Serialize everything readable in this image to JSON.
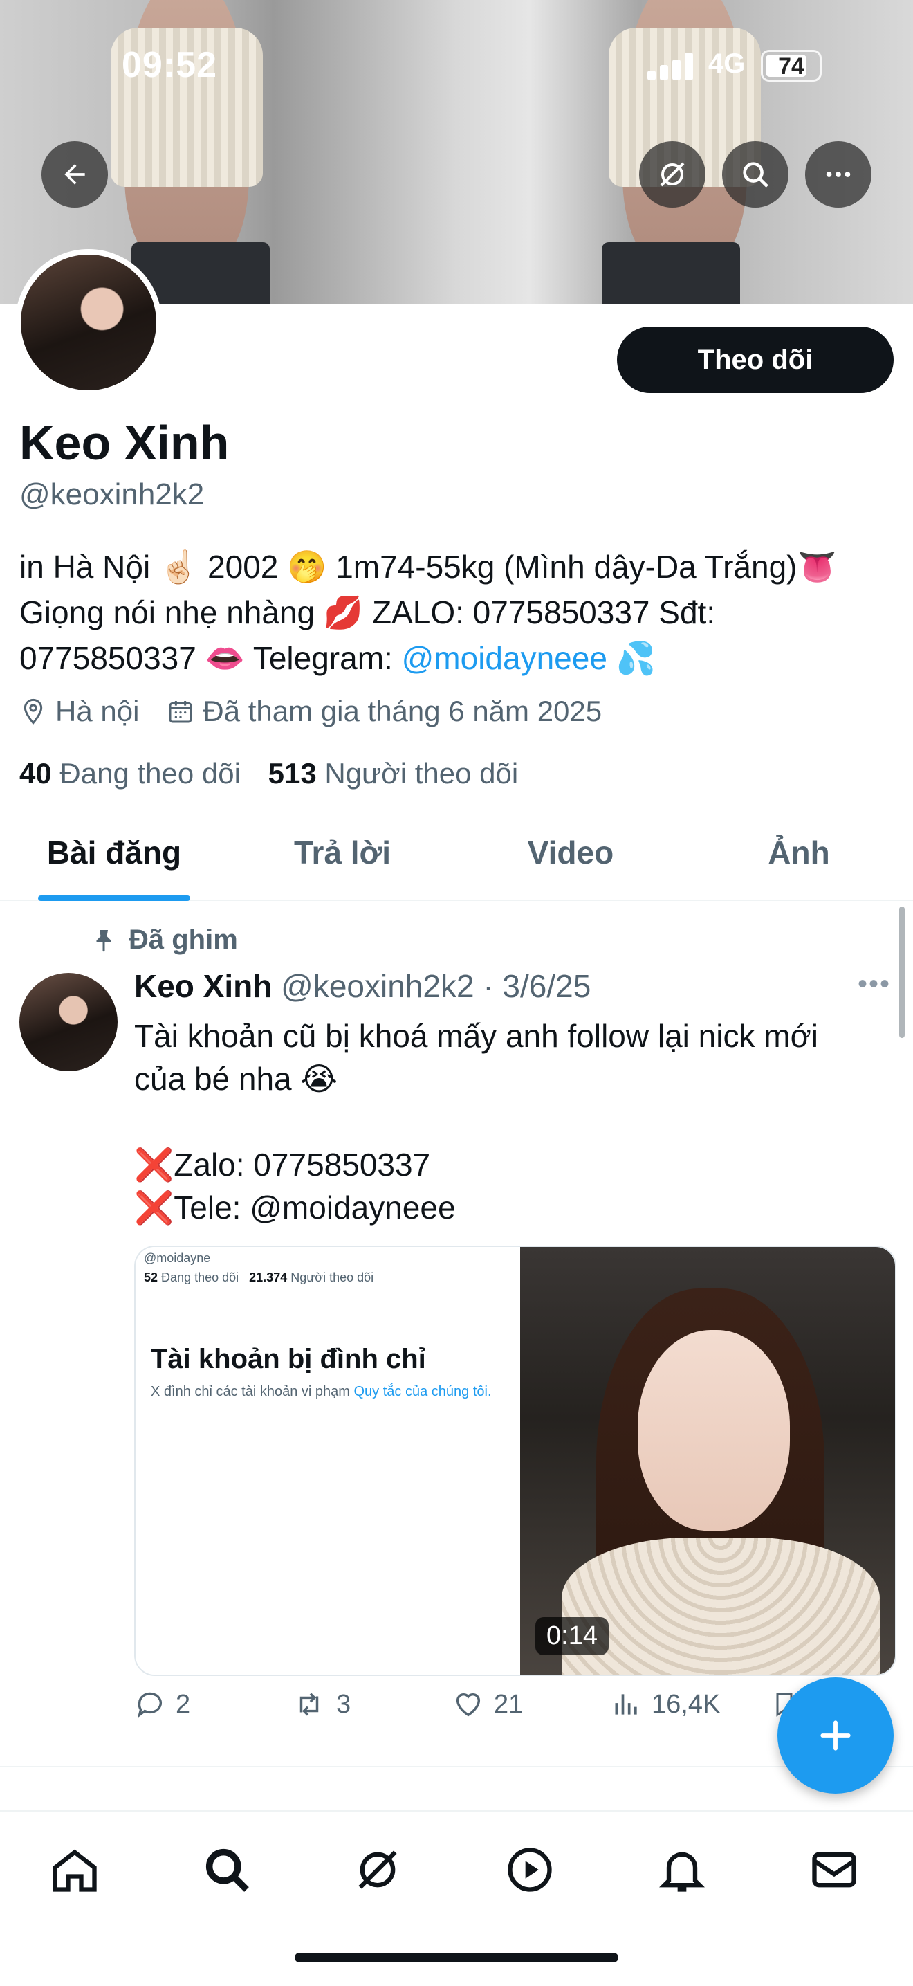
{
  "status_bar": {
    "time": "09:52",
    "network": "4G",
    "battery": "74"
  },
  "header": {
    "follow_label": "Theo dõi"
  },
  "profile": {
    "name": "Keo Xinh",
    "handle": "@keoxinh2k2",
    "bio_line1": "in Hà Nội ☝🏻 2002 🤭 1m74-55kg (Mình dây-Da Trắng)👅",
    "bio_line2": "Giọng nói nhẹ nhàng 💋 ZALO: 0775850337 Sđt:",
    "bio_line3_a": "0775850337 👄 Telegram: ",
    "bio_link": "@moidayneee",
    "bio_line3_b": " 💦",
    "location": "Hà nội",
    "joined": "Đã tham gia tháng 6 năm 2025",
    "following_count": "40",
    "following_label": "Đang theo dõi",
    "followers_count": "513",
    "followers_label": "Người theo dõi"
  },
  "tabs": [
    {
      "label": "Bài đăng",
      "active": true
    },
    {
      "label": "Trả lời"
    },
    {
      "label": "Video"
    },
    {
      "label": "Ảnh"
    }
  ],
  "post": {
    "pinned_label": "Đã ghim",
    "author": "Keo Xinh",
    "meta": "@keoxinh2k2 · 3/6/25",
    "text_line1": "Tài khoản cũ bị khoá mấy anh follow lại nick mới",
    "text_line2": "của bé nha 😭",
    "x_mark": "❌",
    "zalo_line": "Zalo: 0775850337",
    "tele_line": "Tele: @moidayneee",
    "media": {
      "mini_handle": "@moidayne",
      "mini_following": "52",
      "mini_following_label": "Đang theo dõi",
      "mini_followers": "21.374",
      "mini_followers_label": "Người theo dõi",
      "suspended_title": "Tài khoản bị đình chỉ",
      "suspended_sub": "X đình chỉ các tài khoản vi phạm ",
      "suspended_link": "Quy tắc của chúng tôi.",
      "duration": "0:14"
    },
    "replies": "2",
    "reposts": "3",
    "likes": "21",
    "views": "16,4K"
  }
}
